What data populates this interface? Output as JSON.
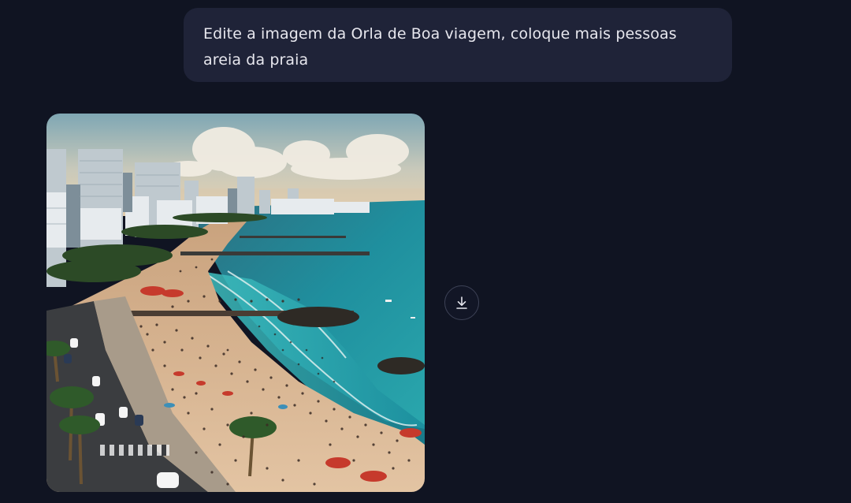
{
  "chat": {
    "user_message": "Edite a imagem da Orla de Boa viagem, coloque mais pessoas areia da praia"
  },
  "image_actions": {
    "download_icon": "download-icon"
  },
  "colors": {
    "background": "#101422",
    "user_bubble": "#1f2338",
    "text": "#e7e7ee"
  }
}
